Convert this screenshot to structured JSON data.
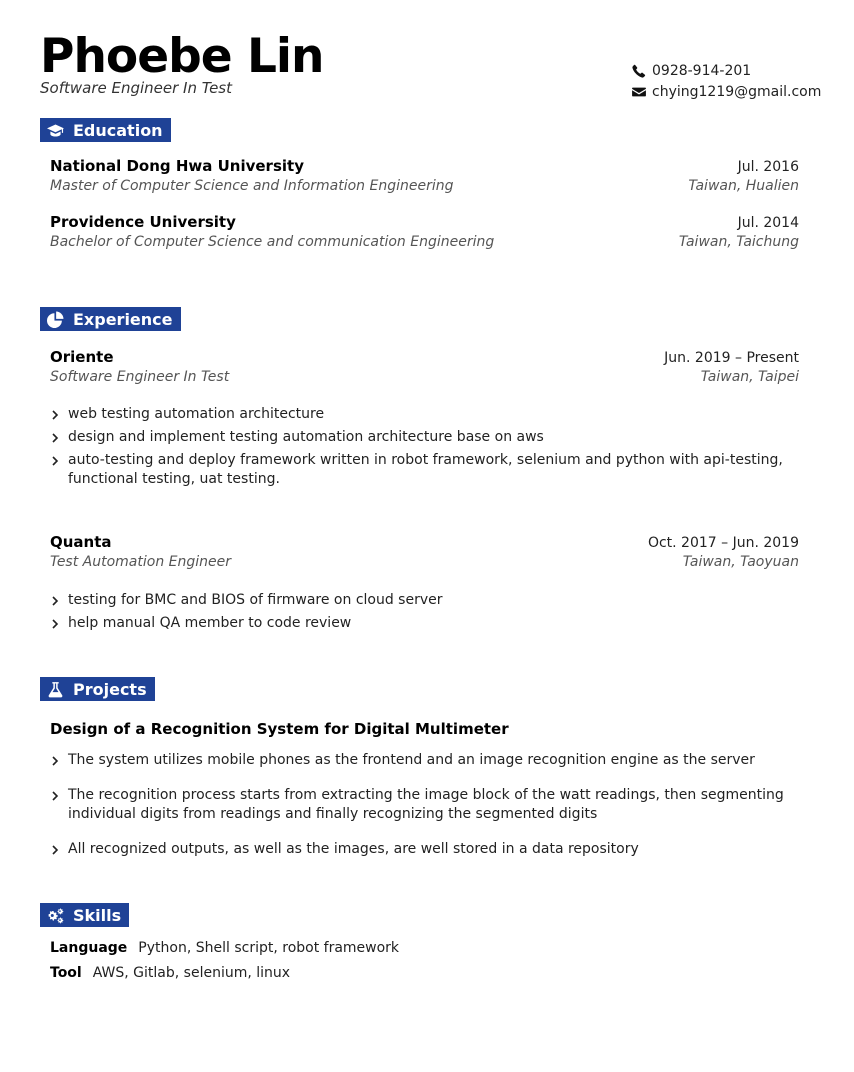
{
  "header": {
    "name": "Phoebe Lin",
    "role": "Software Engineer In Test",
    "phone": "0928-914-201",
    "email": "chying1219@gmail.com",
    "phone_icon": "phone-icon",
    "email_icon": "envelope-icon"
  },
  "colors": {
    "accent": "#1f4296"
  },
  "education": {
    "heading": "Education",
    "icon": "graduation-cap-icon",
    "entries": [
      {
        "org": "National Dong Hwa University",
        "date": "Jul. 2016",
        "degree": "Master of Computer Science and Information Engineering",
        "location": "Taiwan, Hualien"
      },
      {
        "org": "Providence University",
        "date": "Jul. 2014",
        "degree": "Bachelor of Computer Science and communication Engineering",
        "location": "Taiwan, Taichung"
      }
    ]
  },
  "experience": {
    "heading": "Experience",
    "icon": "pie-chart-icon",
    "entries": [
      {
        "org": "Oriente",
        "date": "Jun. 2019 – Present",
        "title": "Software Engineer In Test",
        "location": "Taiwan, Taipei",
        "bullets": [
          "web testing automation architecture",
          "design and implement testing automation architecture base on aws",
          "auto-testing and deploy framework written in robot framework, selenium and python with api-testing, functional testing, uat testing."
        ]
      },
      {
        "org": "Quanta",
        "date": "Oct. 2017 – Jun. 2019",
        "title": "Test Automation Engineer",
        "location": "Taiwan, Taoyuan",
        "bullets": [
          "testing for BMC and BIOS of firmware on cloud server",
          "help manual QA member to code review"
        ]
      }
    ]
  },
  "projects": {
    "heading": "Projects",
    "icon": "flask-icon",
    "title": "Design of a Recognition System for Digital Multimeter",
    "bullets": [
      "The system utilizes mobile phones as the frontend and an image recognition engine as the server",
      "The recognition process starts from extracting the image block of the watt readings, then segmenting individual digits from readings and finally recognizing the segmented digits",
      "All recognized outputs, as well as the images, are well stored in a data repository"
    ]
  },
  "skills": {
    "heading": "Skills",
    "icon": "gears-icon",
    "items": [
      {
        "label": "Language",
        "value": "Python, Shell script, robot framework"
      },
      {
        "label": "Tool",
        "value": "AWS, Gitlab, selenium, linux"
      }
    ]
  }
}
